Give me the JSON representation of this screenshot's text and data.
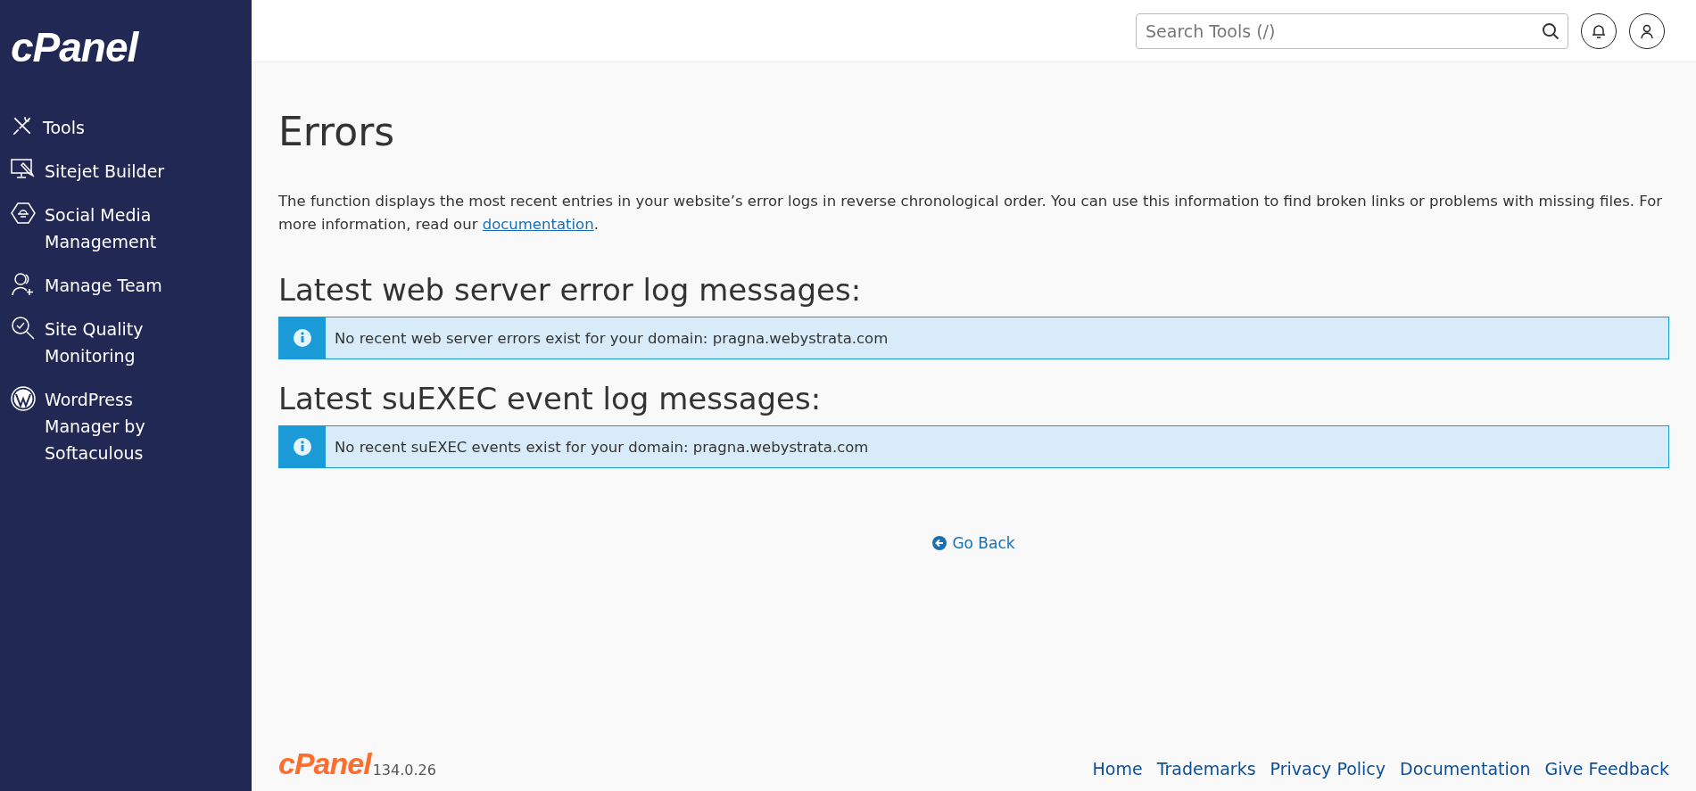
{
  "sidebar": {
    "logo": "cPanel",
    "items": [
      {
        "kind": "tools",
        "label": "Tools"
      },
      {
        "kind": "builder",
        "label": "Sitejet Builder"
      },
      {
        "kind": "social",
        "label": "Social Media Management"
      },
      {
        "kind": "team",
        "label": "Manage Team"
      },
      {
        "kind": "quality",
        "label": "Site Quality Monitoring"
      },
      {
        "kind": "wordpress",
        "label": "WordPress Manager by Softaculous"
      }
    ]
  },
  "topbar": {
    "search": {
      "placeholder": "Search Tools (/)"
    }
  },
  "page": {
    "title": "Errors",
    "description": "The function displays the most recent entries in your website’s error logs in reverse chronological order. You can use this information to find broken links or problems with missing files. For more information, read our ",
    "description_link": "documentation",
    "description_end": ".",
    "sections": [
      {
        "heading": "Latest web server error log messages:",
        "message": "No recent web server errors exist for your domain: pragna.webystrata.com"
      },
      {
        "heading": "Latest suEXEC event log messages:",
        "message": "No recent suEXEC events exist for your domain: pragna.webystrata.com"
      }
    ],
    "back_link": "Go Back"
  },
  "footer": {
    "logo": "cPanel",
    "version": "134.0.26",
    "links": [
      "Home",
      "Trademarks",
      "Privacy Policy",
      "Documentation",
      "Give Feedback"
    ]
  }
}
